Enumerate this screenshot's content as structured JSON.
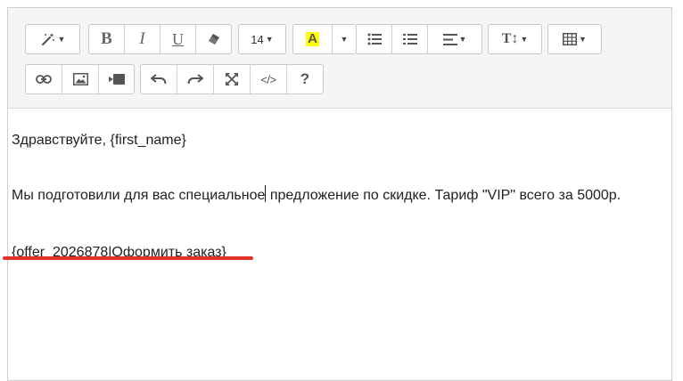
{
  "toolbar": {
    "font_size": "14",
    "icons": [
      "magic-wand",
      "bold",
      "italic",
      "underline",
      "eraser",
      "font-size",
      "highlight",
      "unordered-list",
      "ordered-list",
      "align",
      "text-height",
      "table",
      "link",
      "picture",
      "video",
      "undo",
      "redo",
      "fullscreen",
      "code-view",
      "help"
    ],
    "bold_glyph": "B",
    "italic_glyph": "I",
    "underline_glyph": "U",
    "highlight_glyph": "A",
    "text_height_glyph": "T↕",
    "code_glyph": "</>",
    "help_glyph": "?",
    "highlight_color": "#ffff00"
  },
  "content": {
    "greeting": "Здравствуйте, {first_name}",
    "offer_before_cursor": "Мы подготовили для вас специальное",
    "offer_after_cursor": " предложение по скидке. Тариф \"VIP\" всего за 5000р.",
    "offer_tag": "{offer_2026878|Оформить заказ}"
  },
  "colors": {
    "toolbar_bg": "#f5f5f5",
    "border": "#cfcfcf",
    "annotation_underline": "#e2302b"
  }
}
